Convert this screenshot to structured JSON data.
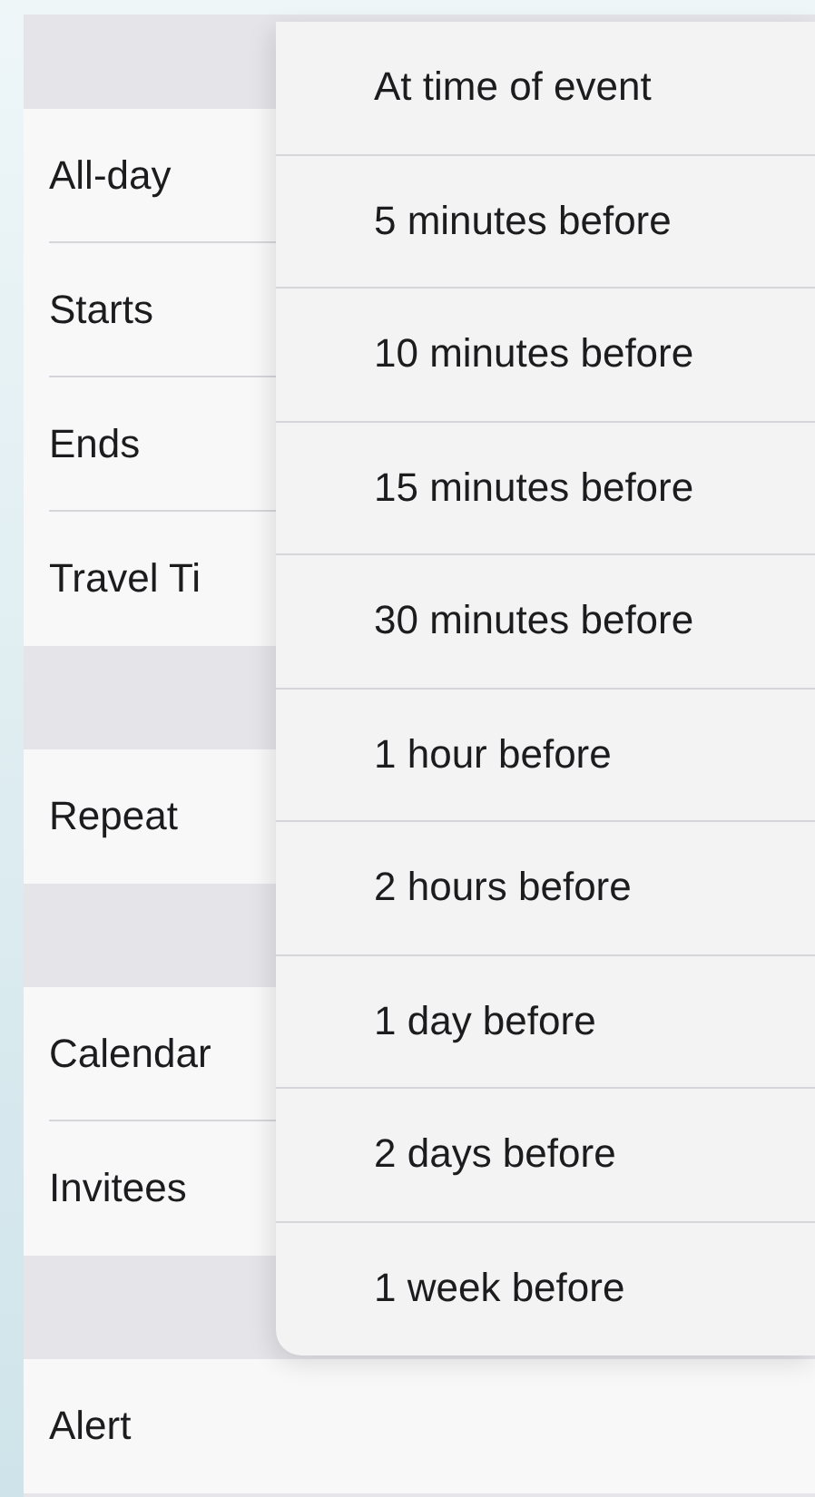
{
  "form": {
    "sections": [
      {
        "rows": [
          "All-day",
          "Starts",
          "Ends",
          "Travel Ti"
        ]
      },
      {
        "rows": [
          "Repeat"
        ]
      },
      {
        "rows": [
          "Calendar",
          "Invitees"
        ]
      },
      {
        "rows": [
          "Alert"
        ]
      }
    ]
  },
  "alert_menu": {
    "options": [
      "At time of event",
      "5 minutes before",
      "10 minutes before",
      "15 minutes before",
      "30 minutes before",
      "1 hour before",
      "2 hours before",
      "1 day before",
      "2 days before",
      "1 week before"
    ]
  }
}
